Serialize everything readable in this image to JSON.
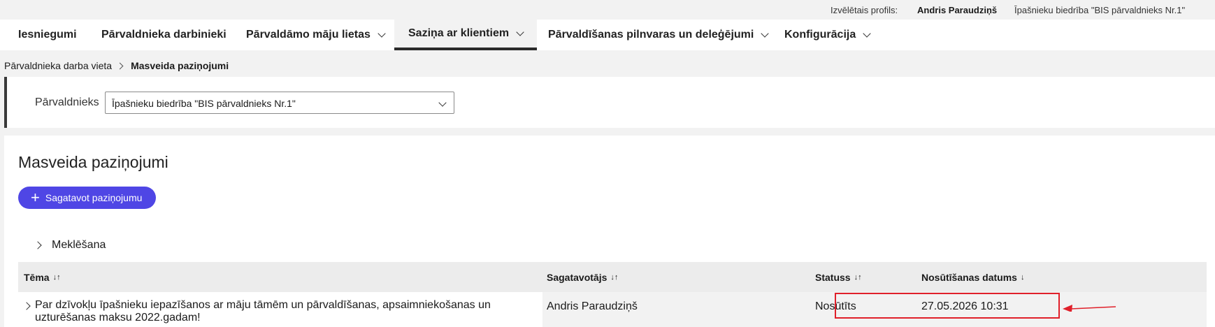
{
  "topbar": {
    "profile_label": "Izvēlētais profils:",
    "user_name": "Andris Paraudziņš",
    "organization": "Īpašnieku biedrība \"BIS pārvaldnieks Nr.1\""
  },
  "nav": {
    "items": [
      {
        "label": "Iesniegumi"
      },
      {
        "label": "Pārvaldnieka darbinieki"
      },
      {
        "label": "Pārvaldāmo māju lietas"
      },
      {
        "label": "Saziņa ar klientiem"
      },
      {
        "label": "Pārvaldīšanas pilnvaras un deleģējumi"
      },
      {
        "label": "Konfigurācija"
      }
    ]
  },
  "breadcrumb": {
    "parent": "Pārvaldnieka darba vieta",
    "current": "Masveida paziņojumi"
  },
  "filter": {
    "label": "Pārvaldnieks",
    "selected": "Īpašnieku biedrība \"BIS pārvaldnieks Nr.1\""
  },
  "main": {
    "title": "Masveida paziņojumi",
    "create_button": "Sagatavot paziņojumu",
    "search_toggle": "Meklēšana"
  },
  "table": {
    "columns": [
      {
        "label": "Tēma",
        "sort": "↓↑"
      },
      {
        "label": "Sagatavotājs",
        "sort": "↓↑"
      },
      {
        "label": "Statuss",
        "sort": "↓↑"
      },
      {
        "label": "Nosūtīšanas datums",
        "sort": "↓"
      }
    ],
    "rows": [
      {
        "topic": "Par dzīvokļu īpašnieku iepazīšanos ar māju tāmēm un pārvaldīšanas, apsaimniekošanas un uzturēšanas maksu 2022.gadam!",
        "author": "Andris Paraudziņš",
        "status": "Nosūtīts",
        "sent_date": "27.05.2026 10:31"
      }
    ]
  },
  "colors": {
    "accent": "#4f46e5",
    "highlight": "#e0202a"
  }
}
